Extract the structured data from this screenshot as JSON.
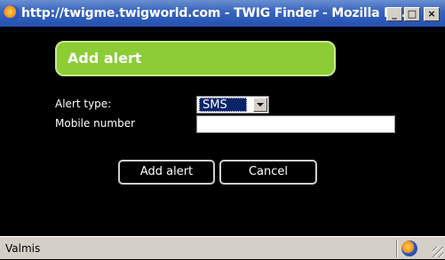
{
  "window": {
    "title": "http://twigme.twigworld.com - TWIG Finder - Mozilla Fir...",
    "min_label": "_",
    "max_label": "□",
    "close_label": "×"
  },
  "dialog": {
    "header": "Add alert",
    "alert_type_label": "Alert type:",
    "alert_type_value": "SMS",
    "mobile_label": "Mobile number",
    "mobile_value": "",
    "add_button": "Add alert",
    "cancel_button": "Cancel"
  },
  "statusbar": {
    "text": "Valmis"
  },
  "colors": {
    "header_bg": "#8ccc34",
    "titlebar": "#2450b0"
  }
}
